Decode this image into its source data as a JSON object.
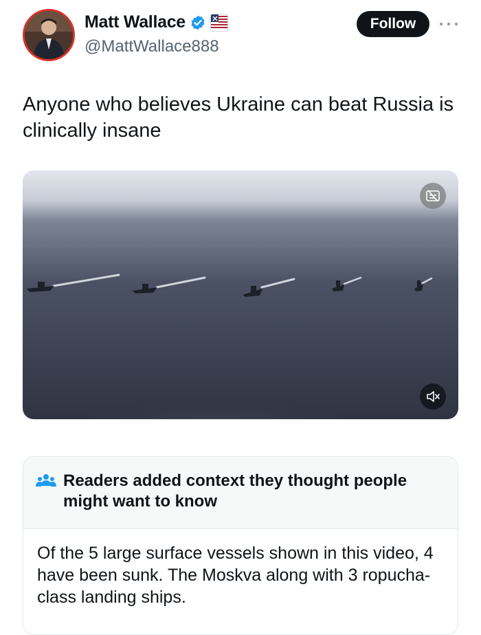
{
  "author": {
    "display_name": "Matt Wallace",
    "handle": "@MattWallace888",
    "verified": true,
    "icons": [
      "verified-badge-icon",
      "affiliate-flag-icon"
    ]
  },
  "actions": {
    "follow_label": "Follow",
    "more_icon": "ellipsis-icon"
  },
  "tweet": {
    "text": "Anyone who believes Ukraine can beat Russia is clinically insane"
  },
  "media": {
    "type": "video",
    "description_icons": [
      "captions-icon",
      "muted-speaker-icon"
    ]
  },
  "community_note": {
    "title": "Readers added context they thought people might want to know",
    "body": "Of the 5 large surface vessels shown in this video, 4 have been sunk. The Moskva along with 3 ropucha-class landing ships.",
    "icon": "people-icon"
  },
  "colors": {
    "text": "#0f1419",
    "secondary_text": "#536471",
    "verified_blue": "#1d9bf0",
    "follow_button_bg": "#0f1419",
    "note_header_bg": "#f7f9f9",
    "note_icon": "#1d9bf0"
  }
}
